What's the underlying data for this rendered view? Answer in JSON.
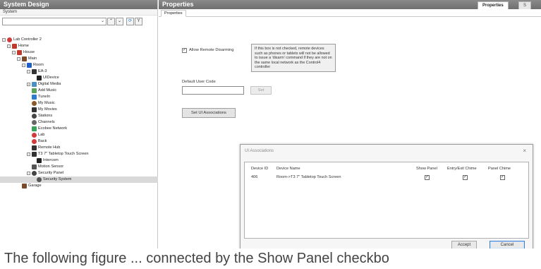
{
  "left_pane": {
    "title": "System Design",
    "subtitle": "System",
    "toolbar": {
      "down_arrow": "⌄",
      "up_btn": "⌃",
      "down_btn": "⌄",
      "refresh_btn": "⟳",
      "filter_btn": "Y"
    },
    "tree": [
      {
        "label": "Lab Controller 2",
        "icon": "controller-icon",
        "color": "#d23b3b"
      },
      {
        "label": "Home",
        "icon": "home-icon",
        "color": "#c0392b"
      },
      {
        "label": "House",
        "icon": "house-icon",
        "color": "#c0392b"
      },
      {
        "label": "Main",
        "icon": "floor-icon",
        "color": "#7b4a2a"
      },
      {
        "label": "Room",
        "icon": "room-icon",
        "color": "#1f5fc6"
      },
      {
        "label": "EA-3",
        "icon": "controller-device-icon",
        "color": "#333333"
      },
      {
        "label": "UIDevice",
        "icon": "ui-device-icon",
        "color": "#222222"
      },
      {
        "label": "Digital Media",
        "icon": "digital-media-icon",
        "color": "#4a8fc4"
      },
      {
        "label": "Add Music",
        "icon": "add-music-icon",
        "color": "#5aa35a"
      },
      {
        "label": "TuneIn",
        "icon": "tunein-icon",
        "color": "#2b7bd3"
      },
      {
        "label": "My Music",
        "icon": "music-icon",
        "color": "#8a5a2a"
      },
      {
        "label": "My Movies",
        "icon": "movies-icon",
        "color": "#333333"
      },
      {
        "label": "Stations",
        "icon": "stations-icon",
        "color": "#444444"
      },
      {
        "label": "Channels",
        "icon": "channels-icon",
        "color": "#666666"
      },
      {
        "label": "Ecobee Network",
        "icon": "ecobee-icon",
        "color": "#3aa35a"
      },
      {
        "label": "Lab",
        "icon": "lab-icon",
        "color": "#d23b3b"
      },
      {
        "label": "Back",
        "icon": "back-icon",
        "color": "#d23b3b"
      },
      {
        "label": "Remote Hub",
        "icon": "remote-hub-icon",
        "color": "#333333"
      },
      {
        "label": "T3 7\" Tabletop Touch Screen",
        "icon": "touch-screen-icon",
        "color": "#333333"
      },
      {
        "label": "Intercom",
        "icon": "intercom-icon",
        "color": "#222222"
      },
      {
        "label": "Motion Sensor",
        "icon": "motion-sensor-icon",
        "color": "#555555"
      },
      {
        "label": "Security Panel",
        "icon": "security-panel-icon",
        "color": "#444444"
      },
      {
        "label": "Security System",
        "icon": "security-system-icon",
        "color": "#555555"
      },
      {
        "label": "Garage",
        "icon": "garage-icon",
        "color": "#7b4a2a"
      }
    ]
  },
  "right_pane": {
    "title": "Properties",
    "tab_active": "Properties",
    "tab_other": "S",
    "sub_tab": "Properties",
    "allow_remote_disarming_label": "Allow Remote Disarming",
    "allow_remote_disarming_checked": "✓",
    "info_text": "If this box is not checked, remote devices such as phones or tablets will not be allowed to issue a 'disarm' command if they are not on the same local network as the Control4 controller",
    "default_user_code_label": "Default User Code",
    "default_user_code_value": "",
    "set_button": "Set",
    "set_ui_associations_button": "Set UI Associations"
  },
  "dialog": {
    "title": "UI Associations",
    "close": "×",
    "headers": {
      "device_id": "Device ID",
      "device_name": "Device Name",
      "show_panel": "Show Panel",
      "entry_exit_chime": "Entry/Exit Chime",
      "panel_chime": "Panel Chime"
    },
    "rows": [
      {
        "device_id": "406",
        "device_name": "Room->T3 7\" Tabletop Touch Screen",
        "show_panel": "✓",
        "entry_exit_chime": "✓",
        "panel_chime": "✓"
      }
    ],
    "accept": "Accept",
    "cancel": "Cancel"
  },
  "caption": "The following figure ... connected by the Show Panel checkbo"
}
